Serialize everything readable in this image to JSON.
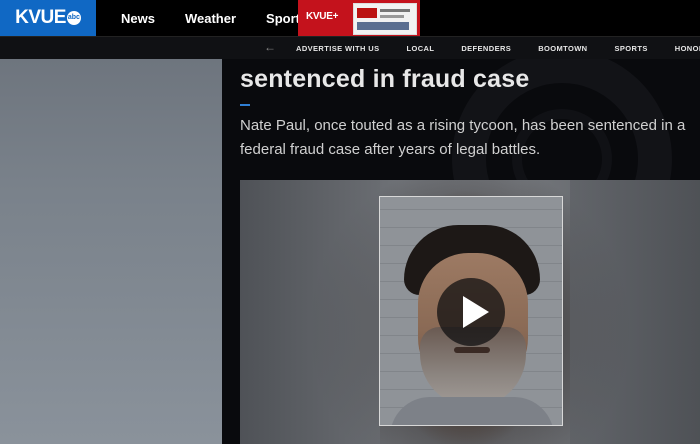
{
  "header": {
    "logo_text": "KVUE",
    "logo_badge": "abc",
    "nav": [
      "News",
      "Weather",
      "Sports"
    ],
    "plus_label": "KVUE+",
    "brand_color": "#1068c4",
    "plus_color": "#c4121c"
  },
  "subnav": {
    "back_icon": "arrow-left-icon",
    "items": [
      "ADVERTISE WITH US",
      "LOCAL",
      "DEFENDERS",
      "BOOMTOWN",
      "SPORTS",
      "HONOR"
    ]
  },
  "article": {
    "headline": "sentenced in fraud case",
    "summary": "Nate Paul, once touted as a rising tycoon, has been sentenced in a federal fraud case after years of legal battles.",
    "accent_color": "#2f7fd4"
  },
  "video": {
    "play_icon": "play-icon"
  }
}
